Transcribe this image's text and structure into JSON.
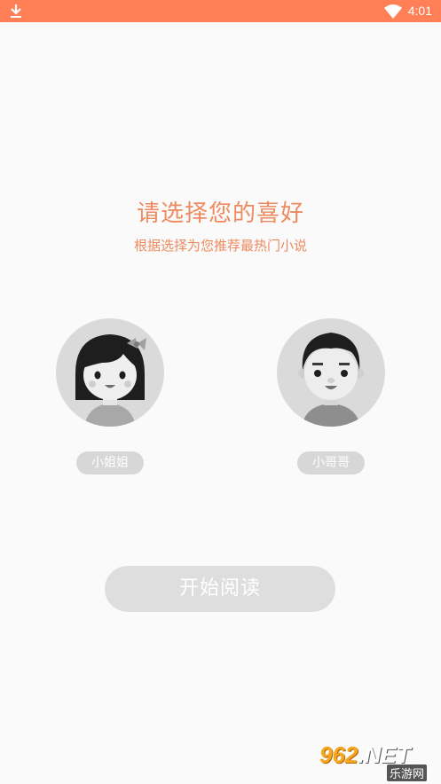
{
  "status_bar": {
    "time": "4:01",
    "download_icon": "download-icon",
    "wifi_icon": "wifi-icon",
    "battery_icon": "battery-icon",
    "bg_color": "#ff7f56"
  },
  "header": {
    "title": "请选择您的喜好",
    "subtitle": "根据选择为您推荐最热门小说",
    "accent_color": "#ee8a5f"
  },
  "choices": [
    {
      "label": "小姐姐",
      "avatar_icon": "girl-avatar-icon"
    },
    {
      "label": "小哥哥",
      "avatar_icon": "boy-avatar-icon"
    }
  ],
  "start_button": {
    "label": "开始阅读"
  },
  "watermark": {
    "brand": "962",
    "suffix": ".NET",
    "site": "乐游网"
  }
}
